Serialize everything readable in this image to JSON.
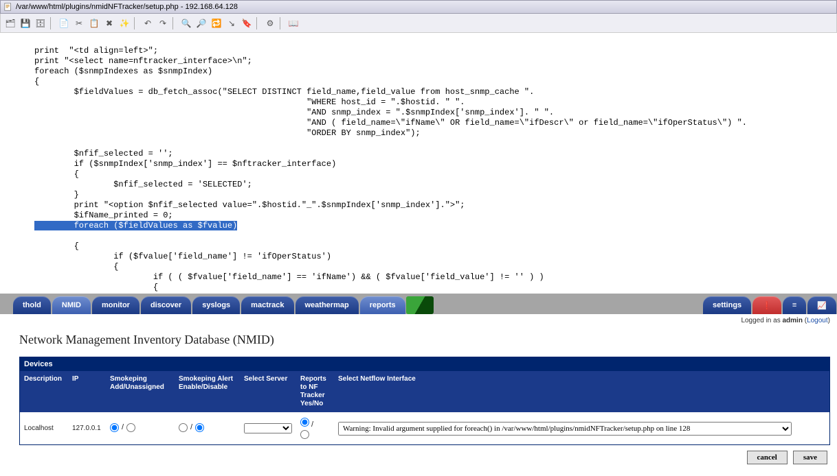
{
  "window": {
    "title": "/var/www/html/plugins/nmidNFTracker/setup.php - 192.168.64.128"
  },
  "editor": {
    "lines": [
      "print  \"<td align=left>\";",
      "print \"<select name=nftracker_interface>\\n\";",
      "foreach ($snmpIndexes as $snmpIndex)",
      "{",
      "        $fieldValues = db_fetch_assoc(\"SELECT DISTINCT field_name,field_value from host_snmp_cache \".",
      "                                                       \"WHERE host_id = \".$hostid. \" \".",
      "                                                       \"AND snmp_index = \".$snmpIndex['snmp_index']. \" \".",
      "                                                       \"AND ( field_name=\\\"ifName\\\" OR field_name=\\\"ifDescr\\\" or field_name=\\\"ifOperStatus\\\") \".",
      "                                                       \"ORDER BY snmp_index\");",
      "",
      "        $nfif_selected = '';",
      "        if ($snmpIndex['snmp_index'] == $nftracker_interface)",
      "        {",
      "                $nfif_selected = 'SELECTED';",
      "        }",
      "        print \"<option $nfif_selected value=\".$hostid.\"_\".$snmpIndex['snmp_index'].\">\";",
      "        $ifName_printed = 0;"
    ],
    "highlighted_line": "        foreach ($fieldValues as $fvalue)",
    "lines_after": [
      "        {",
      "                if ($fvalue['field_name'] != 'ifOperStatus')",
      "                {",
      "                        if ( ( $fvalue['field_name'] == 'ifName') && ( $fvalue['field_value'] != '' ) )",
      "                        {",
      "                                if ( $ifName_printed == 0 )",
      "                                {"
    ]
  },
  "tabs": [
    "thold",
    "NMID",
    "monitor",
    "discover",
    "syslogs",
    "mactrack",
    "weathermap",
    "reports"
  ],
  "tabs_right": [
    "settings"
  ],
  "login": {
    "prefix": "Logged in as ",
    "user": "admin",
    "logout": "Logout"
  },
  "page": {
    "title": "Network Management Inventory Database (NMID)"
  },
  "devices": {
    "header": "Devices",
    "cols": {
      "description": "Description",
      "ip": "IP",
      "smokeping_add": "Smokeping Add/Unassigned",
      "smokeping_alert": "Smokeping Alert Enable/Disable",
      "select_server": "Select Server",
      "reports_nf": "Reports to NF Tracker Yes/No",
      "netflow_if": "Select Netflow Interface"
    },
    "rows": [
      {
        "description": "Localhost",
        "ip": "127.0.0.1",
        "smokeping_add": "add",
        "smokeping_alert": "disable",
        "server": "",
        "reports_nf": "yes",
        "netflow_if": "Warning: Invalid argument supplied for foreach() in /var/www/html/plugins/nmidNFTracker/setup.php on line 128"
      }
    ]
  },
  "buttons": {
    "cancel": "cancel",
    "save": "save"
  }
}
